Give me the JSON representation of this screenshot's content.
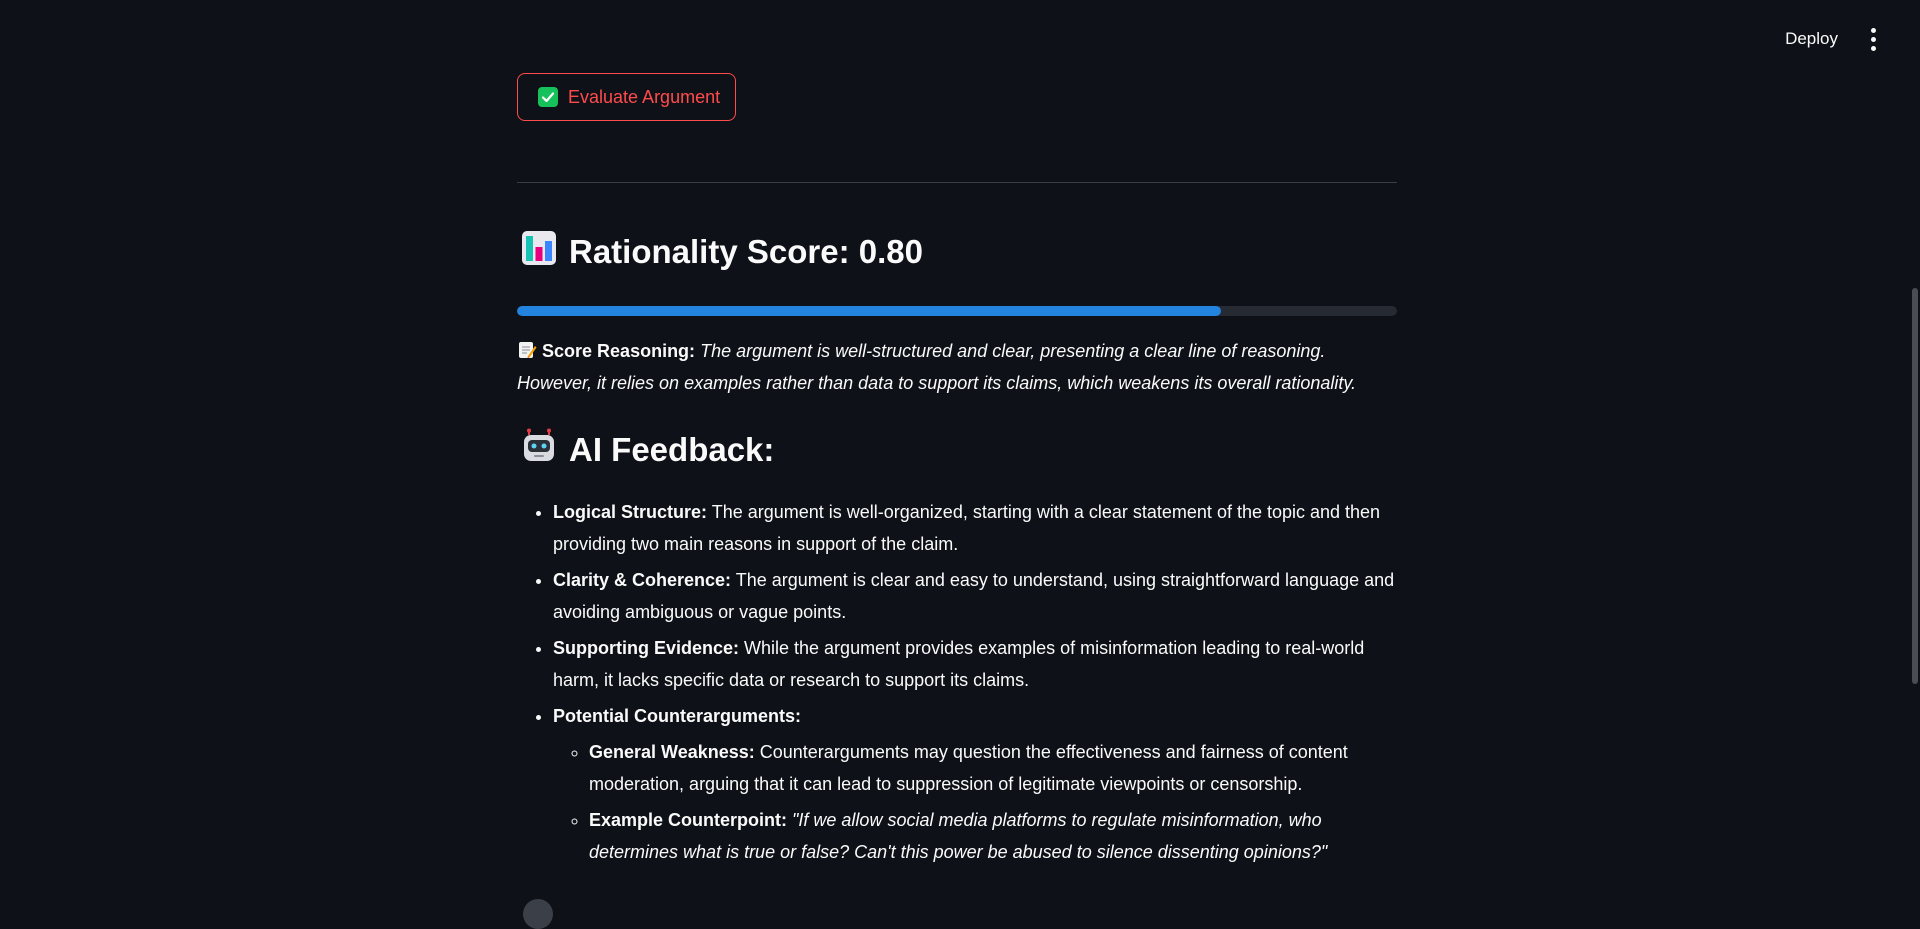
{
  "header": {
    "deploy_label": "Deploy"
  },
  "evaluate_button": {
    "label": "Evaluate Argument",
    "icon": "check-box-icon"
  },
  "score": {
    "heading": "Rationality Score: 0.80",
    "icon": "bar-chart-icon",
    "progress_fraction": 0.8
  },
  "reasoning": {
    "icon": "memo-icon",
    "label": "Score Reasoning:",
    "text": "The argument is well-structured and clear, presenting a clear line of reasoning. However, it relies on examples rather than data to support its claims, which weakens its overall rationality."
  },
  "feedback": {
    "heading": "AI Feedback:",
    "icon": "robot-icon",
    "items": [
      {
        "label": "Logical Structure:",
        "text": " The argument is well-organized, starting with a clear statement of the topic and then providing two main reasons in support of the claim."
      },
      {
        "label": "Clarity & Coherence:",
        "text": " The argument is clear and easy to understand, using straightforward language and avoiding ambiguous or vague points."
      },
      {
        "label": "Supporting Evidence:",
        "text": " While the argument provides examples of misinformation leading to real-world harm, it lacks specific data or research to support its claims."
      },
      {
        "label": "Potential Counterarguments:",
        "text": ""
      }
    ],
    "sub_items": [
      {
        "label": "General Weakness:",
        "text": " Counterarguments may question the effectiveness and fairness of content moderation, arguing that it can lead to suppression of legitimate viewpoints or censorship."
      },
      {
        "label": "Example Counterpoint:",
        "text": " \"If we allow social media platforms to regulate misinformation, who determines what is true or false? Can't this power be abused to silence dissenting opinions?\""
      }
    ]
  },
  "colors": {
    "background": "#0e1117",
    "accent_red": "#ff4b4b",
    "progress_blue": "#2384e0",
    "check_green": "#16c05b"
  }
}
